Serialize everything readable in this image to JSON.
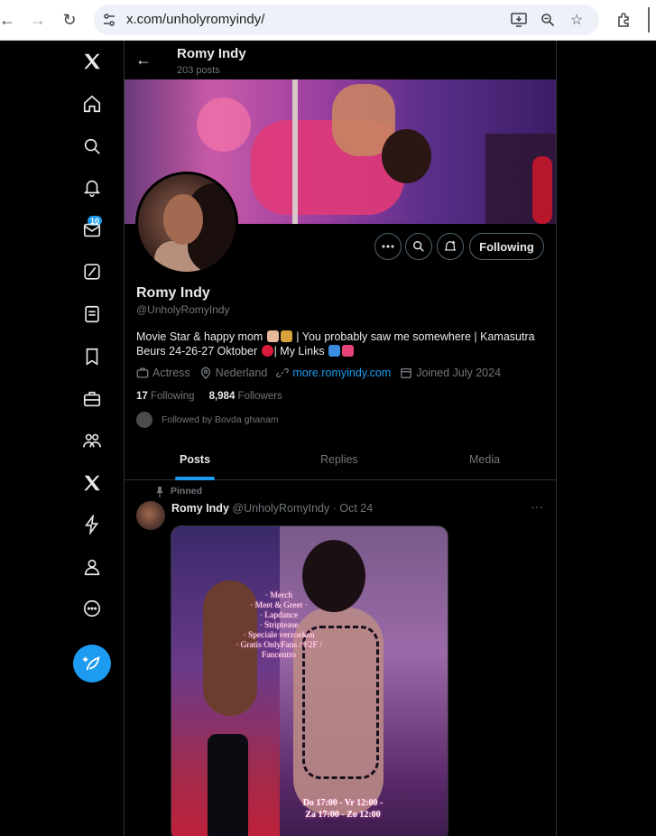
{
  "browser": {
    "url": "x.com/unholyromyindy/",
    "icons": [
      "back-icon",
      "forward-icon",
      "reload-icon",
      "site-info-icon",
      "install-icon",
      "zoom-icon",
      "bookmark-star-icon",
      "extensions-icon"
    ]
  },
  "leftnav": {
    "items": [
      "x-logo-icon",
      "home-icon",
      "explore-icon",
      "notifications-icon",
      "messages-icon",
      "grok-icon",
      "lists-icon",
      "bookmarks-icon",
      "jobs-icon",
      "communities-icon",
      "premium-icon",
      "verified-orgs-icon",
      "profile-icon",
      "more-icon"
    ],
    "notification_count": "10",
    "accent": "#1d9bf0"
  },
  "header": {
    "name": "Romy Indy",
    "posts": "203 posts"
  },
  "profile": {
    "name": "Romy Indy",
    "handle": "@UnholyRomyIndy",
    "bio_part1": "Movie Star & happy mom ",
    "bio_part2": " | You probably saw me somewhere | Kamasutra Beurs 24-26-27 Oktober ",
    "bio_part3": "| My Links ",
    "occupation": "Actress",
    "location": "Nederland",
    "website": "more.romyindy.com",
    "joined": "Joined July 2024",
    "following_count": "17",
    "following_label": "Following",
    "followers_count": "8,984",
    "followers_label": "Followers",
    "followed_by": "Followed by Bovda ghanam",
    "follow_button": "Following"
  },
  "tabs": [
    {
      "label": "Posts",
      "active": true
    },
    {
      "label": "Replies",
      "active": false
    },
    {
      "label": "Media",
      "active": false
    }
  ],
  "post": {
    "pinned_label": "Pinned",
    "author": "Romy Indy",
    "meta": " @UnholyRomyIndy · Oct 24",
    "more": "···",
    "mirror_lines": [
      "· Merch",
      "· Meet & Greet ·",
      "· Lapdance",
      "· Striptease",
      "· Speciale verzoeken",
      "· Gratis OnlyFans / F2F /",
      "Fancentro"
    ],
    "hours_line1": "Do 17:00 - Vr 12:00 -",
    "hours_line2": "Za 17:00 - Zo 12:00"
  }
}
